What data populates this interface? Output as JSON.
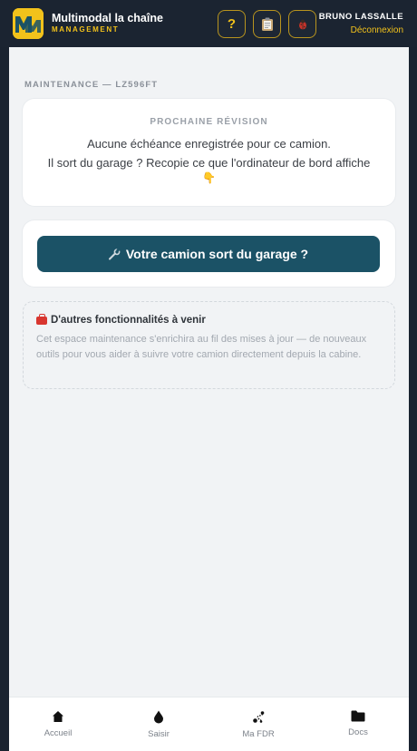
{
  "header": {
    "brand_title": "Multimodal la chaîne",
    "brand_subtitle": "MANAGEMENT",
    "help_label": "?",
    "user_name": "BRUNO LASSALLE",
    "logout_label": "Déconnexion",
    "icons": [
      "logo-mm-icon",
      "help-icon",
      "clipboard-icon",
      "bug-icon"
    ],
    "colors": {
      "accent": "#f2c21b",
      "header_bg": "#1b2431"
    }
  },
  "main": {
    "section_label": "MAINTENANCE — LZ596FT",
    "revision": {
      "title": "PROCHAINE RÉVISION",
      "line1": "Aucune échéance enregistrée pour ce camion.",
      "line2": "Il sort du garage ? Recopie ce que l'ordinateur de bord affiche",
      "emoji": "👇"
    },
    "action_button": {
      "icon": "wrench-icon",
      "label": "Votre camion sort du garage ?",
      "color": "#1b5266"
    },
    "coming": {
      "icon": "toolbox-icon",
      "title": "D'autres fonctionnalités à venir",
      "description": "Cet espace maintenance s'enrichira au fil des mises à jour — de nouveaux outils pour vous aider à suivre votre camion directement depuis la cabine."
    }
  },
  "nav": {
    "items": [
      {
        "label": "Accueil",
        "icon": "home-icon"
      },
      {
        "label": "Saisir",
        "icon": "drop-icon"
      },
      {
        "label": "Ma FDR",
        "icon": "route-icon"
      },
      {
        "label": "Docs",
        "icon": "folder-icon"
      }
    ]
  }
}
